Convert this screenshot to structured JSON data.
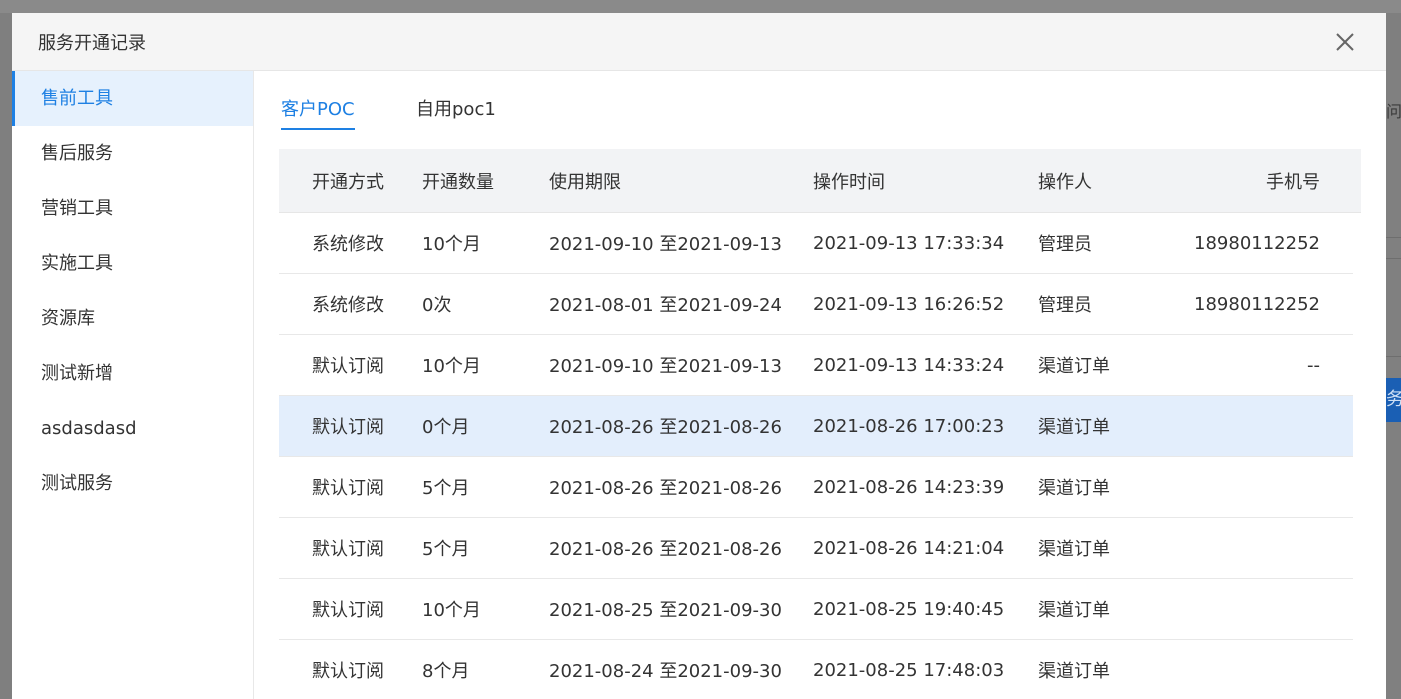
{
  "modal": {
    "title": "服务开通记录"
  },
  "sidebar": {
    "items": [
      {
        "label": "售前工具",
        "active": true
      },
      {
        "label": "售后服务",
        "active": false
      },
      {
        "label": "营销工具",
        "active": false
      },
      {
        "label": "实施工具",
        "active": false
      },
      {
        "label": "资源库",
        "active": false
      },
      {
        "label": "测试新增",
        "active": false
      },
      {
        "label": "asdasdasd",
        "active": false
      },
      {
        "label": "测试服务",
        "active": false
      }
    ]
  },
  "tabs": [
    {
      "label": "客户POC",
      "active": true
    },
    {
      "label": "自用poc1",
      "active": false
    }
  ],
  "table": {
    "columns": [
      "开通方式",
      "开通数量",
      "使用期限",
      "操作时间",
      "操作人",
      "手机号"
    ],
    "rows": [
      {
        "method": "系统修改",
        "quantity": "10个月",
        "period": "2021-09-10 至2021-09-13",
        "time": "2021-09-13 17:33:34",
        "operator": "管理员",
        "phone": "18980112252",
        "highlighted": false
      },
      {
        "method": "系统修改",
        "quantity": "0次",
        "period": "2021-08-01 至2021-09-24",
        "time": "2021-09-13 16:26:52",
        "operator": "管理员",
        "phone": "18980112252",
        "highlighted": false
      },
      {
        "method": "默认订阅",
        "quantity": "10个月",
        "period": "2021-09-10 至2021-09-13",
        "time": "2021-09-13 14:33:24",
        "operator": "渠道订单",
        "phone": "--",
        "highlighted": false
      },
      {
        "method": "默认订阅",
        "quantity": "0个月",
        "period": "2021-08-26 至2021-08-26",
        "time": "2021-08-26 17:00:23",
        "operator": "渠道订单",
        "phone": "",
        "highlighted": true
      },
      {
        "method": "默认订阅",
        "quantity": "5个月",
        "period": "2021-08-26 至2021-08-26",
        "time": "2021-08-26 14:23:39",
        "operator": "渠道订单",
        "phone": "",
        "highlighted": false
      },
      {
        "method": "默认订阅",
        "quantity": "5个月",
        "period": "2021-08-26 至2021-08-26",
        "time": "2021-08-26 14:21:04",
        "operator": "渠道订单",
        "phone": "",
        "highlighted": false
      },
      {
        "method": "默认订阅",
        "quantity": "10个月",
        "period": "2021-08-25 至2021-09-30",
        "time": "2021-08-25 19:40:45",
        "operator": "渠道订单",
        "phone": "",
        "highlighted": false
      },
      {
        "method": "默认订阅",
        "quantity": "8个月",
        "period": "2021-08-24 至2021-09-30",
        "time": "2021-08-25 17:48:03",
        "operator": "渠道订单",
        "phone": "",
        "highlighted": false
      }
    ]
  },
  "background": {
    "edge_char": "问",
    "edge_button_char": "务"
  },
  "colors": {
    "accent": "#1e80e3",
    "active_bg": "#e6f1fd",
    "row_highlight": "#e3eefc",
    "header_bg": "#f2f3f5"
  },
  "icons": {
    "close": "close-icon"
  }
}
